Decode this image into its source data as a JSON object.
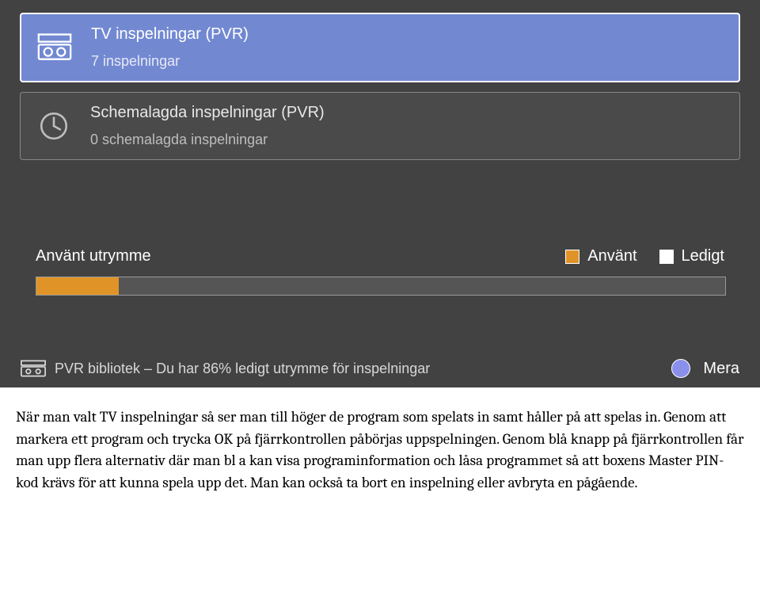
{
  "menu": {
    "items": [
      {
        "title": "TV inspelningar (PVR)",
        "subtitle": "7 inspelningar",
        "icon": "tape-icon"
      },
      {
        "title": "Schemalagda inspelningar (PVR)",
        "subtitle": "0 schemalagda inspelningar",
        "icon": "clock-icon"
      }
    ]
  },
  "storage": {
    "title": "Använt utrymme",
    "legend_used": "Använt",
    "legend_free": "Ledigt",
    "used_percent": 14,
    "colors": {
      "used": "#e09428",
      "free": "#ffffff"
    }
  },
  "footer": {
    "text": "PVR bibliotek – Du har 86% ledigt utrymme för inspelningar",
    "more_label": "Mera"
  },
  "caption": "När man valt TV inspelningar så ser man till höger de program som spelats in samt håller på att spelas in. Genom att markera ett program och trycka OK på fjärrkontrollen påbörjas uppspelningen. Genom blå knapp på fjärrkontrollen får man upp flera alternativ där man bl a kan visa programinformation och låsa programmet så att boxens Master PIN-kod krävs för att kunna spela upp det. Man kan också ta bort en inspelning eller avbryta en pågående."
}
